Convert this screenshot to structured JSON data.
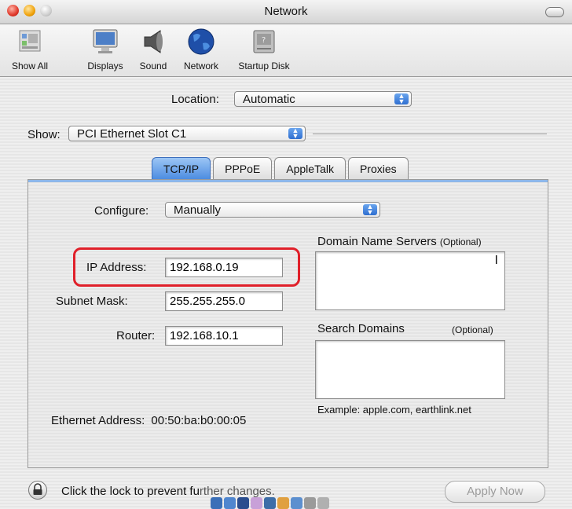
{
  "window": {
    "title": "Network"
  },
  "toolbar": {
    "items": [
      {
        "label": "Show All",
        "icon": "show-all-icon"
      },
      {
        "label": "Displays",
        "icon": "displays-icon"
      },
      {
        "label": "Sound",
        "icon": "sound-icon"
      },
      {
        "label": "Network",
        "icon": "network-globe-icon"
      },
      {
        "label": "Startup Disk",
        "icon": "startup-disk-icon"
      }
    ]
  },
  "location": {
    "label": "Location:",
    "value": "Automatic"
  },
  "show": {
    "label": "Show:",
    "value": "PCI Ethernet Slot C1"
  },
  "tabs": [
    {
      "label": "TCP/IP",
      "active": true
    },
    {
      "label": "PPPoE",
      "active": false
    },
    {
      "label": "AppleTalk",
      "active": false
    },
    {
      "label": "Proxies",
      "active": false
    }
  ],
  "tcpip": {
    "configure": {
      "label": "Configure:",
      "value": "Manually"
    },
    "ip_address": {
      "label": "IP Address:",
      "value": "192.168.0.19"
    },
    "subnet_mask": {
      "label": "Subnet Mask:",
      "value": "255.255.255.0"
    },
    "router": {
      "label": "Router:",
      "value": "192.168.10.1"
    },
    "dns": {
      "label": "Domain Name Servers",
      "optional": "(Optional)",
      "value": ""
    },
    "search_domains": {
      "label": "Search Domains",
      "optional": "(Optional)",
      "value": ""
    },
    "example": "Example: apple.com, earthlink.net",
    "ethernet_address": {
      "label": "Ethernet Address:",
      "value": "00:50:ba:b0:00:05"
    }
  },
  "footer": {
    "lock_text": "Click the lock to prevent fu",
    "lock_text_obscured": "rther changes.",
    "apply_button": "Apply Now"
  },
  "colors": {
    "highlight": "#e0202a",
    "active_tab": "#4a8ae0"
  }
}
